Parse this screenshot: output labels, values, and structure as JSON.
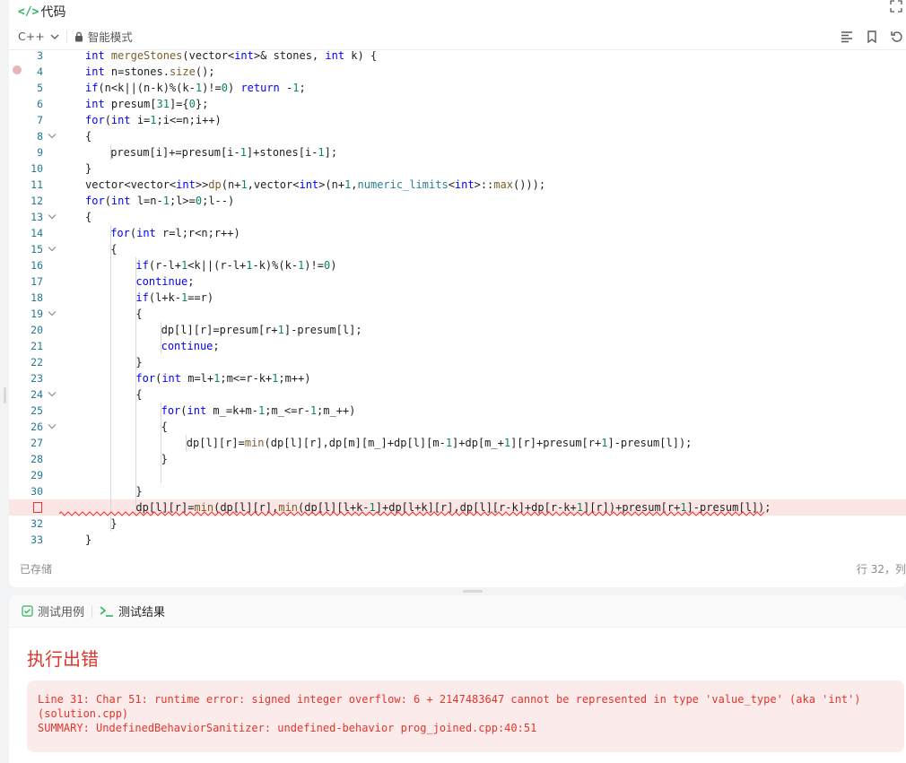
{
  "titlebar": {
    "title": "代码",
    "code_icon": "</>"
  },
  "toolbar": {
    "language": "C++",
    "mode": "智能模式"
  },
  "editor": {
    "error_line": "31",
    "lines": [
      {
        "n": "3",
        "text": "int mergeStones(vector<int>& stones, int k) {"
      },
      {
        "n": "4",
        "text": "int n=stones.size();"
      },
      {
        "n": "5",
        "text": "if(n<k||(n-k)%(k-1)!=0) return -1;"
      },
      {
        "n": "6",
        "text": "int presum[31]={0};"
      },
      {
        "n": "7",
        "text": "for(int i=1;i<=n;i++)"
      },
      {
        "n": "8",
        "text": "{"
      },
      {
        "n": "9",
        "text": "presum[i]+=presum[i-1]+stones[i-1];"
      },
      {
        "n": "10",
        "text": "}"
      },
      {
        "n": "11",
        "text": "vector<vector<int>>dp(n+1,vector<int>(n+1,numeric_limits<int>::max()));"
      },
      {
        "n": "12",
        "text": "for(int l=n-1;l>=0;l--)"
      },
      {
        "n": "13",
        "text": "{"
      },
      {
        "n": "14",
        "text": "for(int r=l;r<n;r++)"
      },
      {
        "n": "15",
        "text": "{"
      },
      {
        "n": "16",
        "text": "if(r-l+1<k||(r-l+1-k)%(k-1)!=0)"
      },
      {
        "n": "17",
        "text": "continue;"
      },
      {
        "n": "18",
        "text": "if(l+k-1==r)"
      },
      {
        "n": "19",
        "text": "{"
      },
      {
        "n": "20",
        "text": "dp[l][r]=presum[r+1]-presum[l];"
      },
      {
        "n": "21",
        "text": "continue;"
      },
      {
        "n": "22",
        "text": "}"
      },
      {
        "n": "23",
        "text": "for(int m=l+1;m<=r-k+1;m++)"
      },
      {
        "n": "24",
        "text": "{"
      },
      {
        "n": "25",
        "text": "for(int m_=k+m-1;m_<=r-1;m_++)"
      },
      {
        "n": "26",
        "text": "{"
      },
      {
        "n": "27",
        "text": "dp[l][r]=min(dp[l][r],dp[m][m_]+dp[l][m-1]+dp[m_+1][r]+presum[r+1]-presum[l]);"
      },
      {
        "n": "28",
        "text": "}"
      },
      {
        "n": "29",
        "text": ""
      },
      {
        "n": "30",
        "text": "}"
      },
      {
        "n": "31",
        "text": "dp[l][r]=min(dp[l][r],min(dp[l][l+k-1]+dp[l+k][r],dp[l][r-k]+dp[r-k+1][r])+presum[r+1]-presum[l]);"
      },
      {
        "n": "32",
        "text": "}"
      },
      {
        "n": "33",
        "text": "}"
      }
    ]
  },
  "status": {
    "saved": "已存储",
    "cursor": "行 32，列"
  },
  "bottom": {
    "tab_cases": "测试用例",
    "tab_results": "测试结果",
    "result_title": "执行出错",
    "error_message": "Line 31: Char 51: runtime error: signed integer overflow: 6 + 2147483647 cannot be represented in type 'value_type' (aka 'int') (solution.cpp)\nSUMMARY: UndefinedBehaviorSanitizer: undefined-behavior prog_joined.cpp:40:51"
  },
  "colors": {
    "error": "#e0362a",
    "keyword": "#0000ff",
    "function": "#795e26",
    "number": "#098658",
    "accent": "#2db55d"
  }
}
